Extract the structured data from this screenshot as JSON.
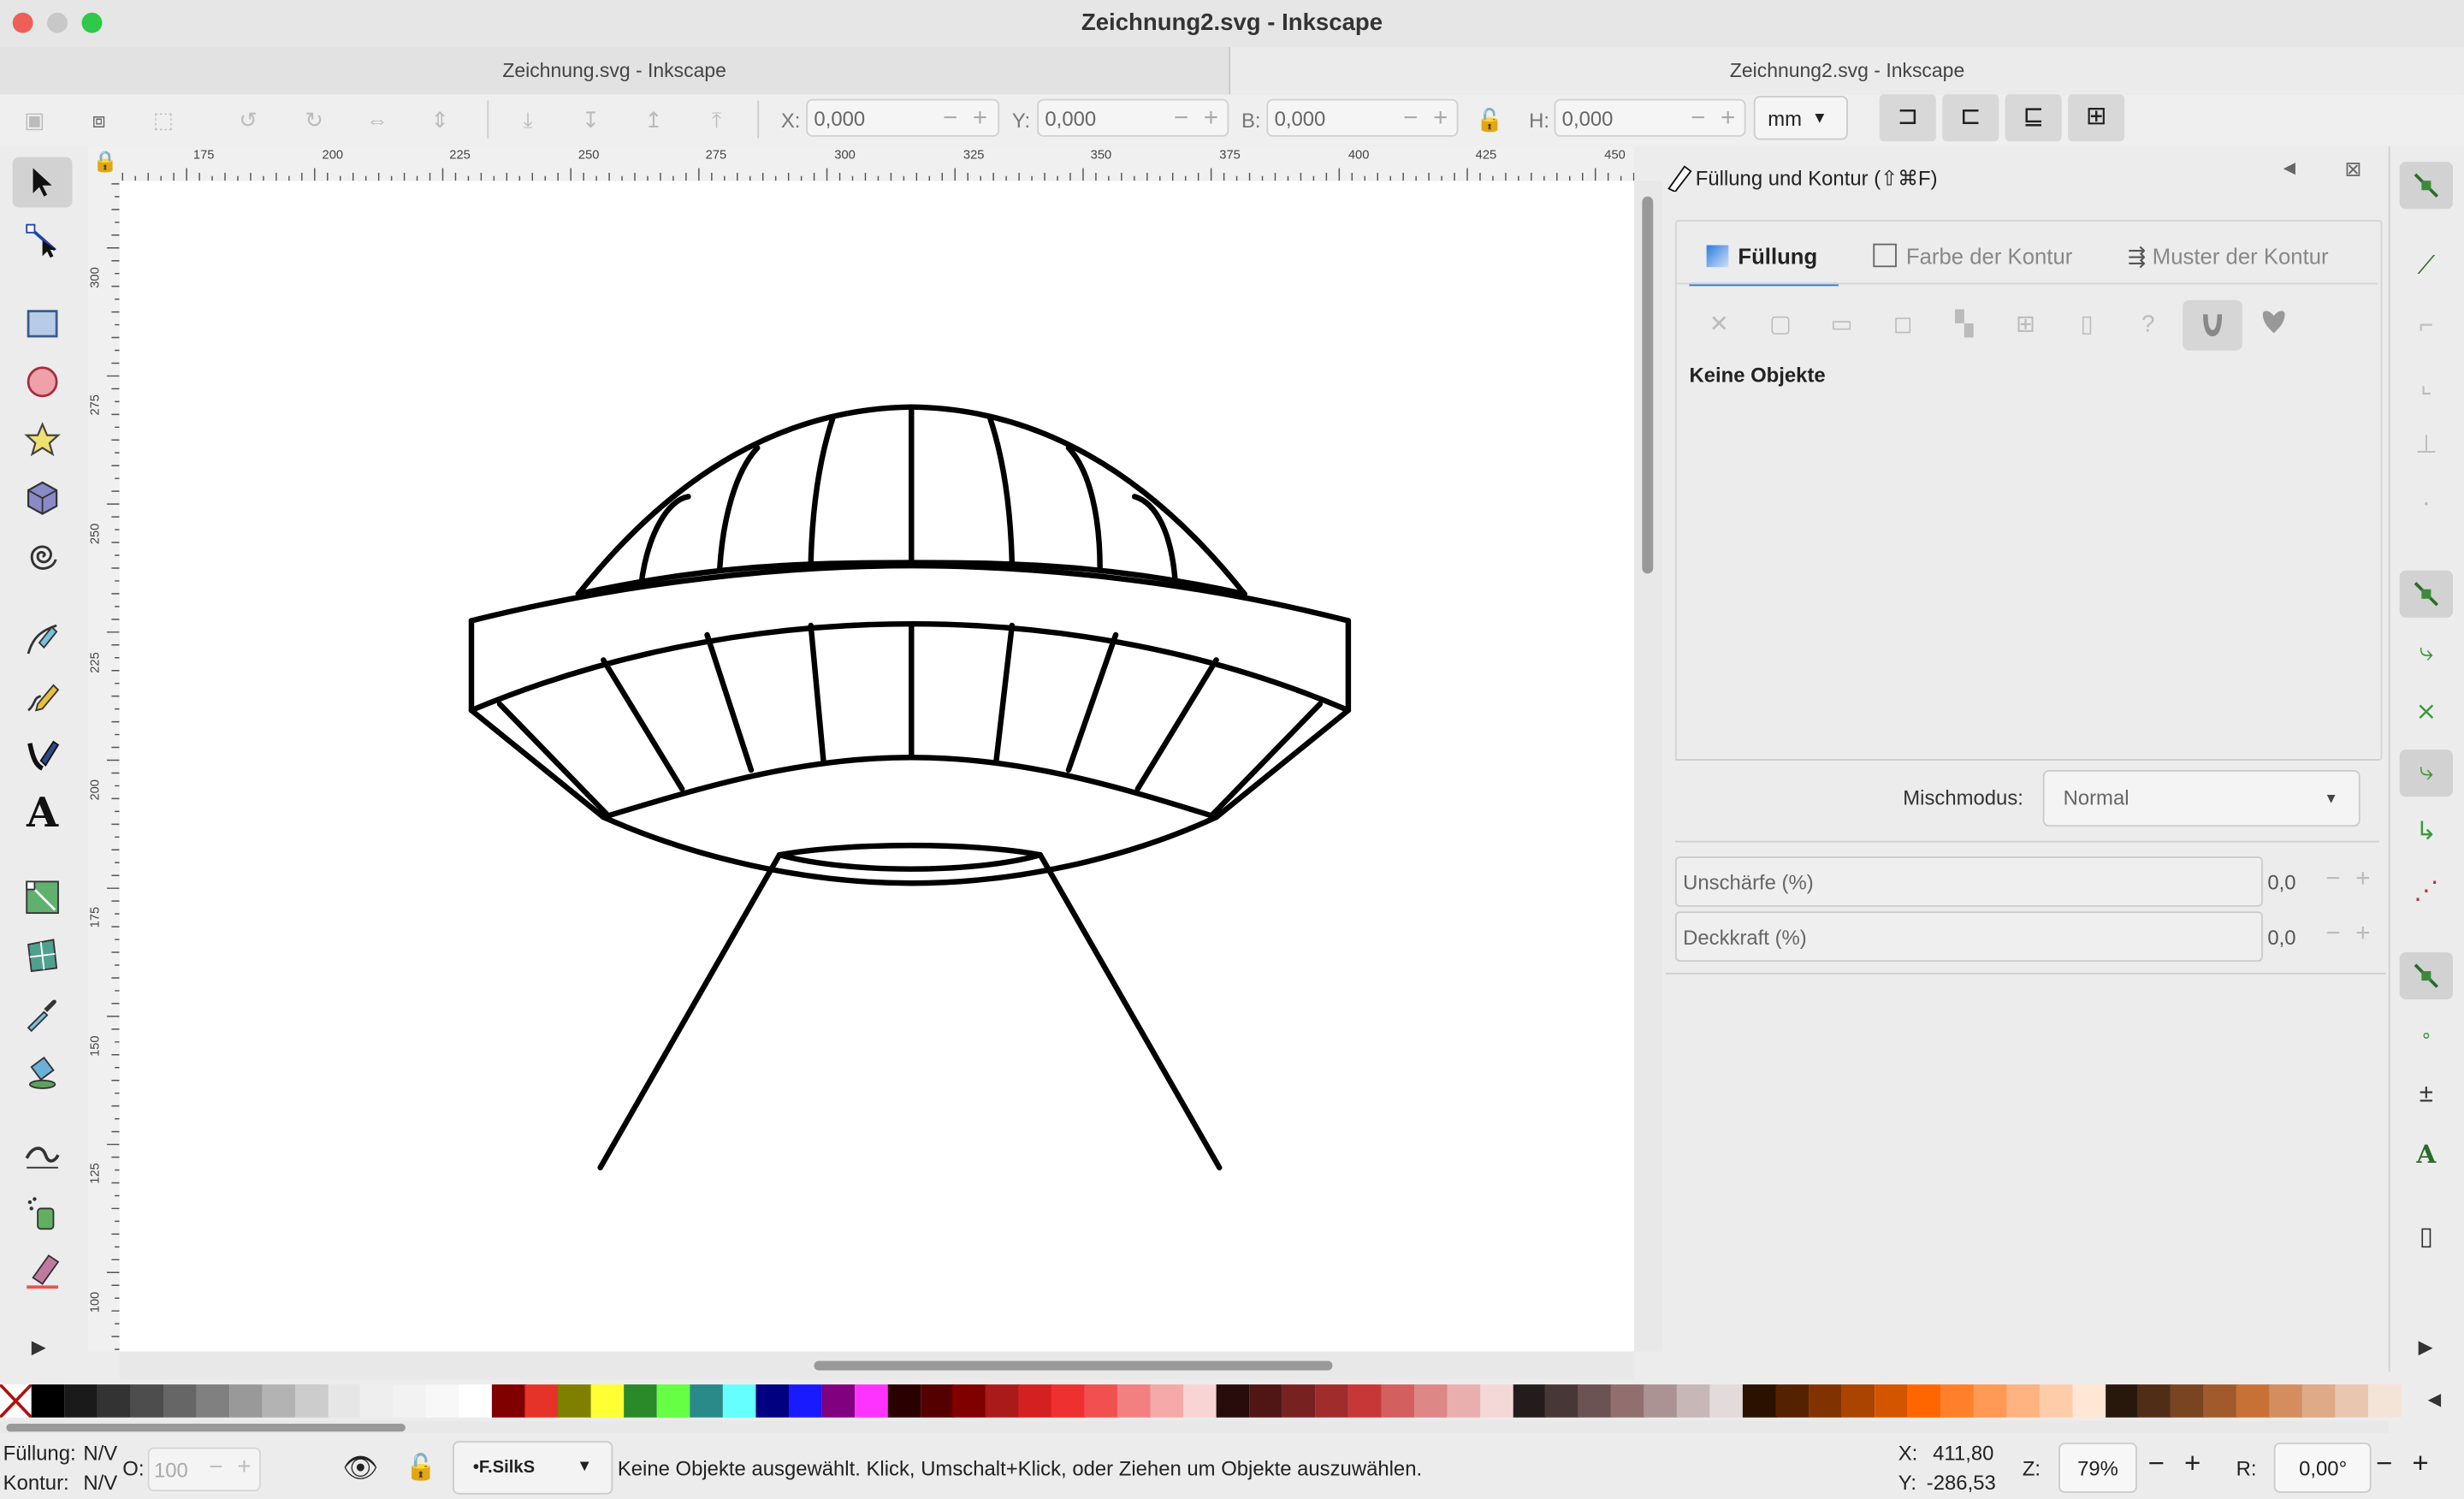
{
  "window": {
    "title": "Zeichnung2.svg - Inkscape",
    "tabs": [
      {
        "label": "Zeichnung.svg - Inkscape",
        "active": false
      },
      {
        "label": "Zeichnung2.svg - Inkscape",
        "active": true
      }
    ]
  },
  "toolbar": {
    "x_label": "X:",
    "x_value": "0,000",
    "y_label": "Y:",
    "y_value": "0,000",
    "w_label": "B:",
    "w_value": "0,000",
    "h_label": "H:",
    "h_value": "0,000",
    "unit": "mm"
  },
  "tools": [
    "selector-tool",
    "node-tool",
    "rectangle-tool",
    "circle-tool",
    "star-tool",
    "3d-box-tool",
    "spiral-tool",
    "pen-tool",
    "pencil-tool",
    "calligraphy-tool",
    "text-tool",
    "gradient-tool",
    "mesh-tool",
    "dropper-tool",
    "paint-bucket-tool",
    "tweak-tool",
    "spray-tool",
    "eraser-tool"
  ],
  "ruler": {
    "h_labels": [
      "175",
      "200",
      "225",
      "250",
      "275",
      "300",
      "325",
      "350",
      "375",
      "400",
      "425",
      "450"
    ],
    "v_labels": [
      "300",
      "275",
      "250",
      "225",
      "200",
      "175",
      "150",
      "125",
      "100"
    ]
  },
  "panel": {
    "title": "Füllung und Kontur (⇧⌘F)",
    "tabs": {
      "fill": "Füllung",
      "stroke_paint": "Farbe der Kontur",
      "stroke_style": "Muster der Kontur"
    },
    "no_objects": "Keine Objekte",
    "blend_label": "Mischmodus:",
    "blend_value": "Normal",
    "blur_label": "Unschärfe (%)",
    "blur_value": "0,0",
    "opacity_label": "Deckkraft (%)",
    "opacity_value": "0,0"
  },
  "status": {
    "fill_label": "Füllung:",
    "fill_value": "N/V",
    "stroke_label": "Kontur:",
    "stroke_value": "N/V",
    "o_label": "O:",
    "o_value": "100",
    "layer": "•F.SilkS",
    "message": "Keine Objekte ausgewählt. Klick, Umschalt+Klick, oder Ziehen um Objekte auszuwählen.",
    "x_label": "X:",
    "x_value": "411,80",
    "y_label": "Y:",
    "y_value": "-286,53",
    "zoom_label": "Z:",
    "zoom_value": "79%",
    "rotate_label": "R:",
    "rotate_value": "0,00°"
  },
  "colors": {
    "accent": "#2d7be0",
    "palette": [
      "#000000",
      "#1a1a1a",
      "#333333",
      "#4d4d4d",
      "#666666",
      "#808080",
      "#999999",
      "#b3b3b3",
      "#cccccc",
      "#e6e6e6",
      "#eeeeee",
      "#f2f2f2",
      "#f8f8f8",
      "#ffffff",
      "#800000",
      "#e5332a",
      "#808000",
      "#ffff33",
      "#2a8a2a",
      "#66ff44",
      "#2a8a8a",
      "#66ffff",
      "#000080",
      "#1a1aff",
      "#800080",
      "#ff33ff",
      "#2b0000",
      "#550000",
      "#800000",
      "#aa1a1a",
      "#d42020",
      "#ee3030",
      "#f05050",
      "#f28080",
      "#f5aaaa",
      "#f8d4d4",
      "#280b0b",
      "#501616",
      "#782121",
      "#a02c2c",
      "#c83737",
      "#d35f5f",
      "#de8787",
      "#e9afaf",
      "#f4d7d7",
      "#241c1c",
      "#483737",
      "#6c5353",
      "#916f6f",
      "#ac9393",
      "#c8b7b7",
      "#e3dbdb",
      "#2b1100",
      "#552200",
      "#803300",
      "#aa4400",
      "#d45500",
      "#ff6600",
      "#ff7f2a",
      "#ff9955",
      "#ffb380",
      "#ffccaa",
      "#ffe6d5",
      "#28170b",
      "#502d16",
      "#784421",
      "#a05a2c",
      "#c87137",
      "#d38d5f",
      "#deaa87",
      "#e9c6af",
      "#f4e3d7"
    ]
  }
}
